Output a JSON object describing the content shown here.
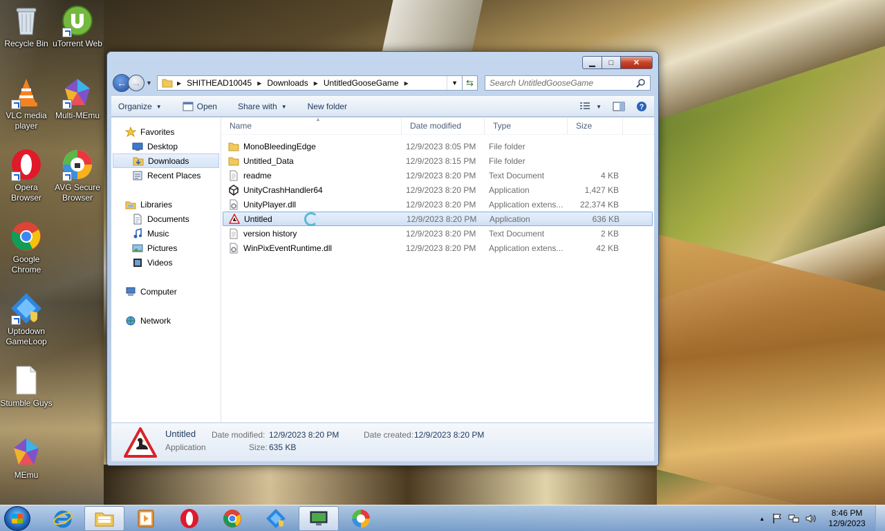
{
  "desktop": {
    "icons": [
      {
        "label": "Recycle Bin"
      },
      {
        "label": "uTorrent Web"
      },
      {
        "label": "VLC media player"
      },
      {
        "label": "Multi-MEmu"
      },
      {
        "label": "Opera Browser"
      },
      {
        "label": "AVG Secure Browser"
      },
      {
        "label": "Google Chrome"
      },
      {
        "label": "Uptodown GameLoop"
      },
      {
        "label": "Stumble Guys"
      },
      {
        "label": "MEmu"
      }
    ]
  },
  "window": {
    "controls": {
      "minimize": "▁",
      "maximize": "□",
      "close": "✕"
    },
    "breadcrumb": [
      "SHITHEAD10045",
      "Downloads",
      "UntitledGooseGame"
    ],
    "search_placeholder": "Search UntitledGooseGame",
    "toolbar": {
      "organize": "Organize",
      "open": "Open",
      "share_with": "Share with",
      "new_folder": "New folder"
    },
    "nav": {
      "favorites": "Favorites",
      "desktop": "Desktop",
      "downloads": "Downloads",
      "recent_places": "Recent Places",
      "libraries": "Libraries",
      "documents": "Documents",
      "music": "Music",
      "pictures": "Pictures",
      "videos": "Videos",
      "computer": "Computer",
      "network": "Network"
    },
    "columns": {
      "name": "Name",
      "date": "Date modified",
      "type": "Type",
      "size": "Size"
    },
    "files": [
      {
        "name": "MonoBleedingEdge",
        "date": "12/9/2023 8:05 PM",
        "type": "File folder",
        "size": "",
        "icon": "folder-icon"
      },
      {
        "name": "Untitled_Data",
        "date": "12/9/2023 8:15 PM",
        "type": "File folder",
        "size": "",
        "icon": "folder-icon"
      },
      {
        "name": "readme",
        "date": "12/9/2023 8:20 PM",
        "type": "Text Document",
        "size": "4 KB",
        "icon": "text-file-icon"
      },
      {
        "name": "UnityCrashHandler64",
        "date": "12/9/2023 8:20 PM",
        "type": "Application",
        "size": "1,427 KB",
        "icon": "unity-icon"
      },
      {
        "name": "UnityPlayer.dll",
        "date": "12/9/2023 8:20 PM",
        "type": "Application extens...",
        "size": "22,374 KB",
        "icon": "dll-icon"
      },
      {
        "name": "Untitled",
        "date": "12/9/2023 8:20 PM",
        "type": "Application",
        "size": "636 KB",
        "icon": "goose-warning-icon"
      },
      {
        "name": "version history",
        "date": "12/9/2023 8:20 PM",
        "type": "Text Document",
        "size": "2 KB",
        "icon": "text-file-icon"
      },
      {
        "name": "WinPixEventRuntime.dll",
        "date": "12/9/2023 8:20 PM",
        "type": "Application extens...",
        "size": "42 KB",
        "icon": "dll-icon"
      }
    ],
    "details": {
      "name": "Untitled",
      "type": "Application",
      "date_modified_label": "Date modified:",
      "date_modified": "12/9/2023 8:20 PM",
      "date_created_label": "Date created:",
      "date_created": "12/9/2023 8:20 PM",
      "size_label": "Size:",
      "size": "635 KB"
    }
  },
  "taskbar": {
    "clock_time": "8:46 PM",
    "clock_date": "12/9/2023",
    "tray_expand": "▲"
  },
  "colors": {
    "selection": "#cfe0f5",
    "selection_border": "#84acdd",
    "toolbar_text": "#1e395b"
  }
}
